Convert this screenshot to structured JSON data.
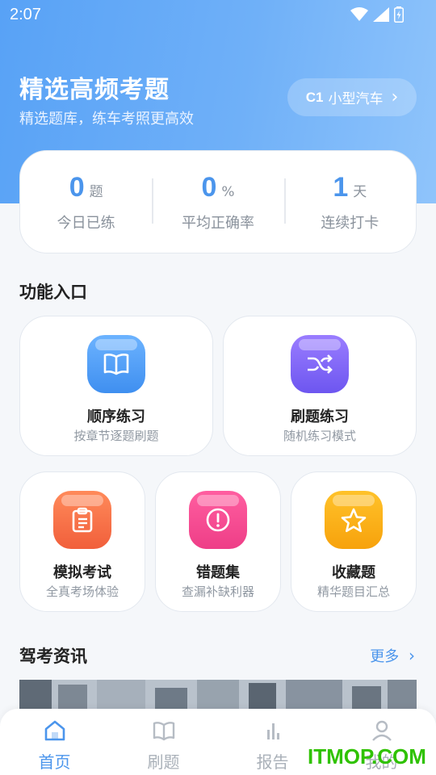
{
  "status_bar": {
    "time": "2:07"
  },
  "hero": {
    "title": "精选高频考题",
    "subtitle": "精选题库，练车考照更高效",
    "license_code": "C1",
    "license_name": "小型汽车",
    "license_chevron": "›"
  },
  "stats": [
    {
      "value": "0",
      "unit": "题",
      "label": "今日已练"
    },
    {
      "value": "0",
      "unit": "%",
      "label": "平均正确率"
    },
    {
      "value": "1",
      "unit": "天",
      "label": "连续打卡"
    }
  ],
  "features_section": {
    "title": "功能入口"
  },
  "features": [
    {
      "title": "顺序练习",
      "subtitle": "按章节逐题刷题",
      "icon": "book-icon",
      "color_from": "#6cb3ff",
      "color_to": "#3f8ff0"
    },
    {
      "title": "刷题练习",
      "subtitle": "随机练习模式",
      "icon": "shuffle-icon",
      "color_from": "#9a7dff",
      "color_to": "#6d56f0"
    },
    {
      "title": "模拟考试",
      "subtitle": "全真考场体验",
      "icon": "clipboard-icon",
      "color_from": "#ff8a5a",
      "color_to": "#f15f3b"
    },
    {
      "title": "错题集",
      "subtitle": "查漏补缺利器",
      "icon": "alert-icon",
      "color_from": "#ff5ea0",
      "color_to": "#ee3e87"
    },
    {
      "title": "收藏题",
      "subtitle": "精华题目汇总",
      "icon": "star-icon",
      "color_from": "#ffc22a",
      "color_to": "#f7a20c"
    }
  ],
  "news_section": {
    "title": "驾考资讯",
    "more_label": "更多",
    "more_chevron": "›"
  },
  "tabbar": [
    {
      "label": "首页",
      "icon": "home-icon",
      "active": true
    },
    {
      "label": "刷题",
      "icon": "book-icon",
      "active": false
    },
    {
      "label": "报告",
      "icon": "chart-icon",
      "active": false
    },
    {
      "label": "我的",
      "icon": "user-icon",
      "active": false
    }
  ],
  "watermark": "ITMOP.COM",
  "colors": {
    "accent": "#4b95ec",
    "hero_from": "#58a2f6",
    "hero_to": "#8fc4fb",
    "watermark": "#2fc200"
  }
}
